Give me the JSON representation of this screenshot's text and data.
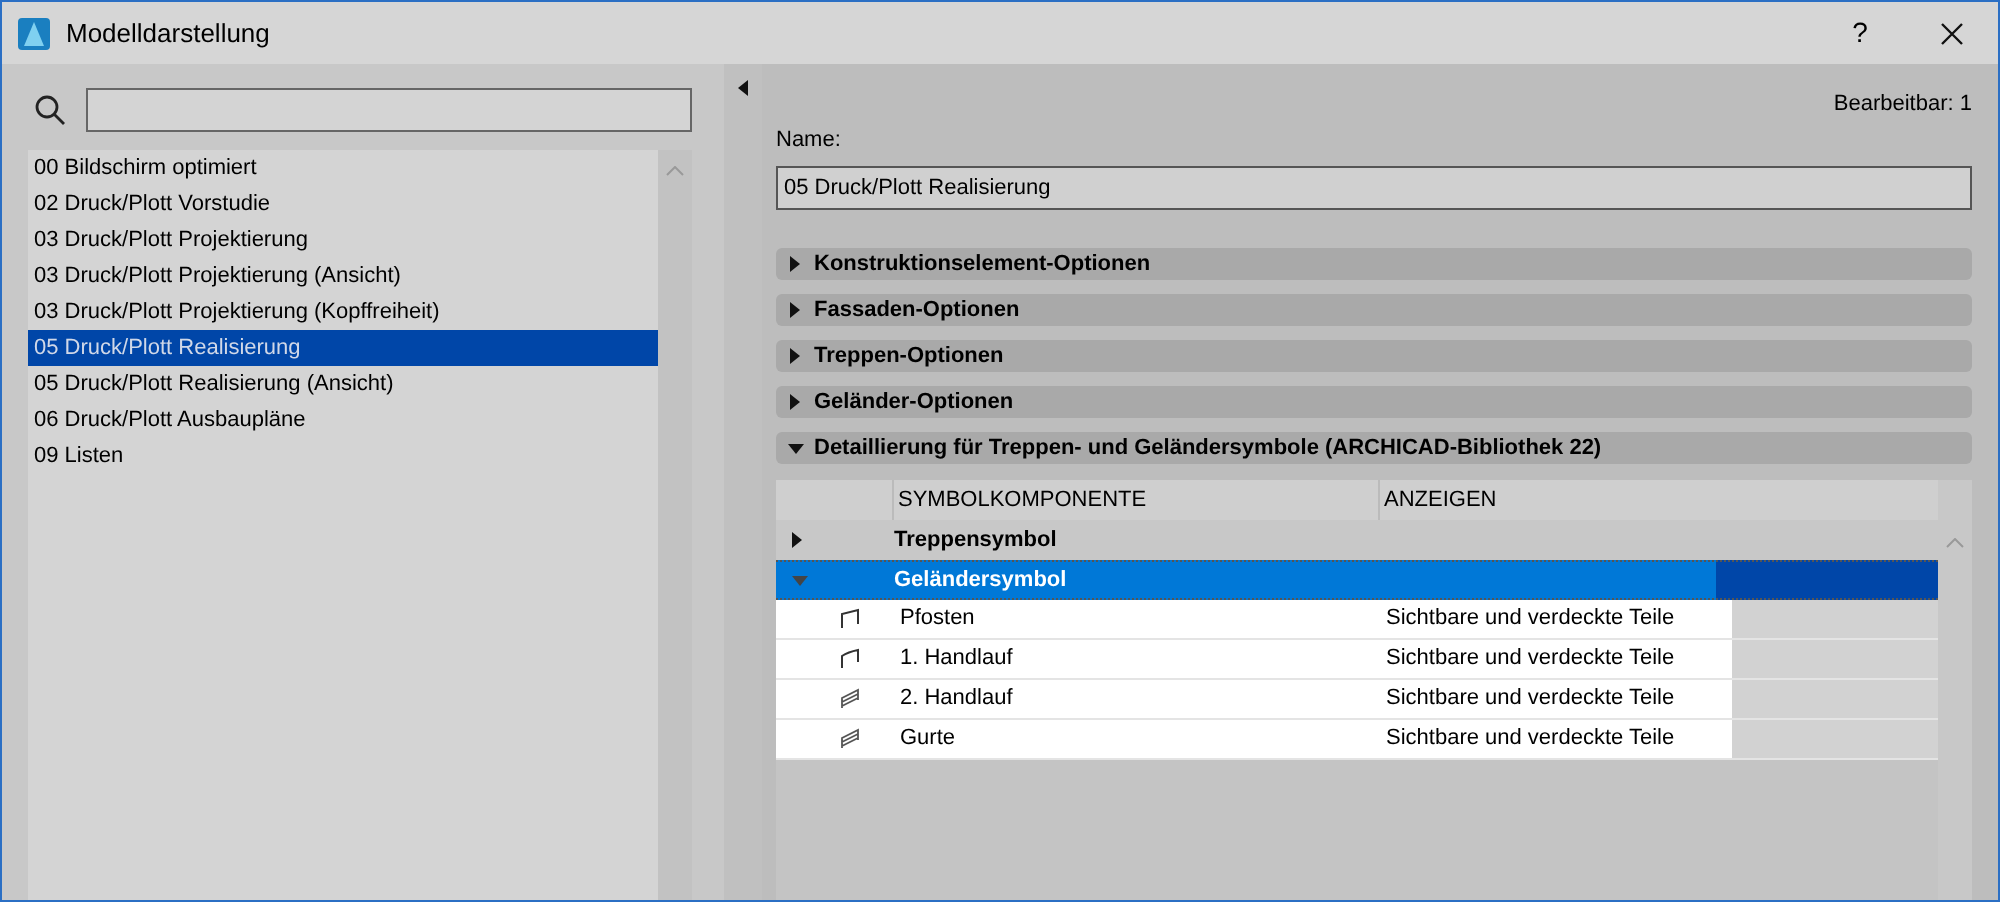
{
  "window": {
    "title": "Modelldarstellung",
    "help": "?"
  },
  "sidebar": {
    "items": [
      {
        "label": "00 Bildschirm optimiert",
        "selected": false
      },
      {
        "label": "02 Druck/Plott Vorstudie",
        "selected": false
      },
      {
        "label": "03 Druck/Plott Projektierung",
        "selected": false
      },
      {
        "label": "03 Druck/Plott Projektierung (Ansicht)",
        "selected": false
      },
      {
        "label": "03 Druck/Plott Projektierung (Kopffreiheit)",
        "selected": false
      },
      {
        "label": "05 Druck/Plott Realisierung",
        "selected": true
      },
      {
        "label": "05 Druck/Plott Realisierung (Ansicht)",
        "selected": false
      },
      {
        "label": "06 Druck/Plott Ausbaupläne",
        "selected": false
      },
      {
        "label": "09 Listen",
        "selected": false
      }
    ]
  },
  "editable": "Bearbeitbar: 1",
  "name": {
    "label": "Name:",
    "value": "05 Druck/Plott Realisierung"
  },
  "sections": [
    {
      "label": "Konstruktionselement-Optionen",
      "expanded": false
    },
    {
      "label": "Fassaden-Optionen",
      "expanded": false
    },
    {
      "label": "Treppen-Optionen",
      "expanded": false
    },
    {
      "label": "Geländer-Optionen",
      "expanded": false
    },
    {
      "label": "Detaillierung für Treppen- und Geländersymbole (ARCHICAD-Bibliothek 22)",
      "expanded": true
    }
  ],
  "table": {
    "columns": [
      "SYMBOLKOMPONENTE",
      "ANZEIGEN"
    ],
    "rows": [
      {
        "label": "Treppensymbol",
        "expanded": false,
        "selected": false,
        "children": []
      },
      {
        "label": "Geländersymbol",
        "expanded": true,
        "selected": true,
        "children": [
          {
            "kind": "post",
            "label": "Pfosten",
            "display": "Sichtbare und verdeckte Teile"
          },
          {
            "kind": "rail",
            "label": "1. Handlauf",
            "display": "Sichtbare und verdeckte Teile"
          },
          {
            "kind": "double",
            "label": "2. Handlauf",
            "display": "Sichtbare und verdeckte Teile"
          },
          {
            "kind": "double",
            "label": "Gurte",
            "display": "Sichtbare und verdeckte Teile"
          }
        ]
      }
    ]
  }
}
